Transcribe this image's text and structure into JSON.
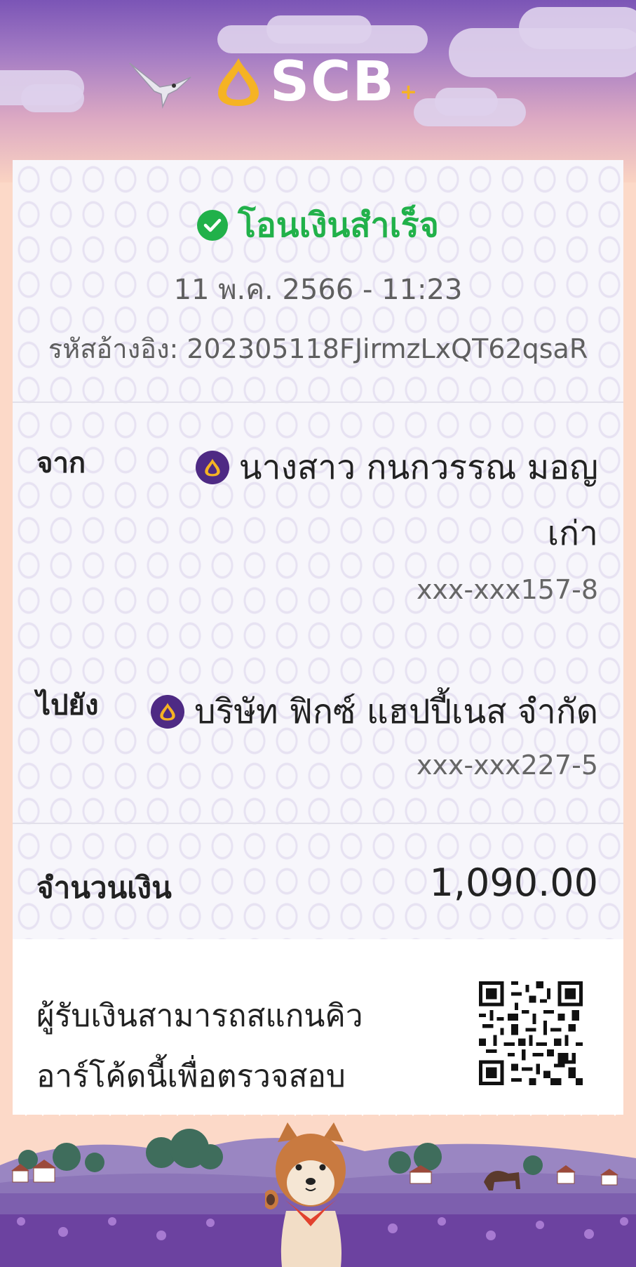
{
  "header": {
    "brand": "SCB",
    "brand_plus": "+"
  },
  "receipt": {
    "status": "โอนเงินสำเร็จ",
    "datetime": "11 พ.ค. 2566 - 11:23",
    "reference": "รหัสอ้างอิง: 202305118FJirmzLxQT62qsaR",
    "from": {
      "label": "จาก",
      "name_line1": "นางสาว กนกวรรณ มอญ",
      "name_line2": "เก่า",
      "account": "xxx-xxx157-8"
    },
    "to": {
      "label": "ไปยัง",
      "name": "บริษัท ฟิกซ์ แฮปปี้เนส จำกัด",
      "account": "xxx-xxx227-5"
    },
    "amount": {
      "label": "จำนวนเงิน",
      "value": "1,090.00"
    },
    "qr": {
      "line1": "ผู้รับเงินสามารถสแกนคิว",
      "line2": "อาร์โค้ดนี้เพื่อตรวจสอบ"
    }
  },
  "colors": {
    "success": "#21b14a",
    "brand_purple": "#4e2a84",
    "brand_gold": "#f5b324"
  }
}
